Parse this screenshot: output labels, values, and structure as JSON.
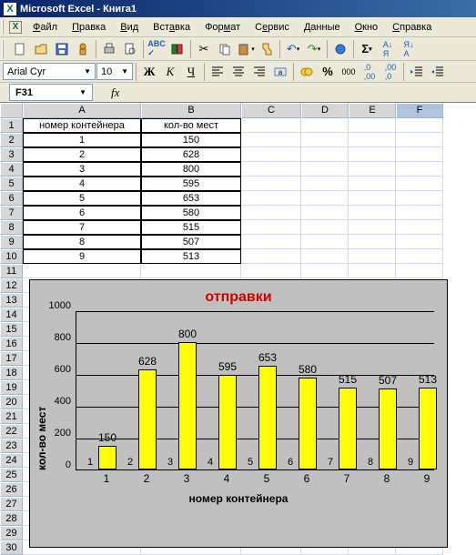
{
  "titlebar": {
    "text": "Microsoft Excel - Книга1"
  },
  "menu": {
    "file": "Файл",
    "edit": "Правка",
    "view": "Вид",
    "insert": "Вставка",
    "format": "Формат",
    "tools": "Сервис",
    "data": "Данные",
    "window": "Окно",
    "help": "Справка"
  },
  "format_bar": {
    "font_name": "Arial Cyr",
    "font_size": "10"
  },
  "name_box": {
    "cell": "F31",
    "fx": "fx"
  },
  "columns": [
    "A",
    "B",
    "C",
    "D",
    "E",
    "F"
  ],
  "rows_visible": 30,
  "table": {
    "header": {
      "a": "номер контейнера",
      "b": "кол-во мест"
    },
    "rows": [
      {
        "a": "1",
        "b": "150"
      },
      {
        "a": "2",
        "b": "628"
      },
      {
        "a": "3",
        "b": "800"
      },
      {
        "a": "4",
        "b": "595"
      },
      {
        "a": "5",
        "b": "653"
      },
      {
        "a": "6",
        "b": "580"
      },
      {
        "a": "7",
        "b": "515"
      },
      {
        "a": "8",
        "b": "507"
      },
      {
        "a": "9",
        "b": "513"
      }
    ]
  },
  "chart_data": {
    "type": "bar",
    "title": "отправки",
    "xlabel": "номер контейнера",
    "ylabel": "кол-во мест",
    "categories": [
      "1",
      "2",
      "3",
      "4",
      "5",
      "6",
      "7",
      "8",
      "9"
    ],
    "values": [
      150,
      628,
      800,
      595,
      653,
      580,
      515,
      507,
      513
    ],
    "ylim": [
      0,
      1000
    ],
    "yticks": [
      0,
      200,
      400,
      600,
      800,
      1000
    ]
  }
}
